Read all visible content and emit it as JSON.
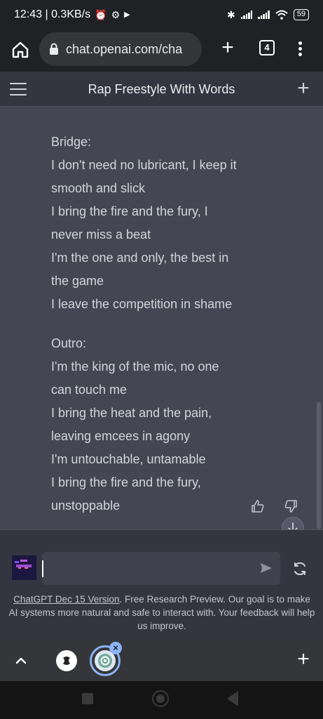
{
  "status_bar": {
    "time_speed": "12:43 | 0.3KB/s",
    "battery": "59"
  },
  "browser": {
    "url": "chat.openai.com/cha",
    "tab_count": "4"
  },
  "chat": {
    "title": "Rap Freestyle With Words",
    "partial_line": "...",
    "stanzas": [
      {
        "lines": [
          "Bridge:",
          "I don't need no lubricant, I keep it",
          "smooth and slick",
          "I bring the fire and the fury, I",
          "never miss a beat",
          "I'm the one and only, the best in",
          "the game",
          "I leave the competition in shame"
        ]
      },
      {
        "lines": [
          "Outro:",
          "I'm the king of the mic, no one",
          "can touch me",
          "I bring the heat and the pain,",
          "leaving emcees in agony",
          "I'm untouchable, untamable",
          "I bring the fire and the fury,",
          "unstoppable"
        ]
      }
    ]
  },
  "input": {
    "value": ""
  },
  "footer": {
    "link_text": "ChatGPT Dec 15 Version",
    "note_text": ". Free Research Preview. Our goal is to make AI systems more natural and safe to interact with. Your feedback will help us improve."
  },
  "icons": {
    "thumbs_up": "thumbs-up-icon",
    "thumbs_down": "thumbs-down-icon",
    "send": "send-icon",
    "regenerate": "refresh-icon"
  },
  "colors": {
    "conversation_bg": "#444654",
    "header_bg": "#343541",
    "input_bg": "#40414f",
    "accent_blue": "#8ab4f8"
  }
}
